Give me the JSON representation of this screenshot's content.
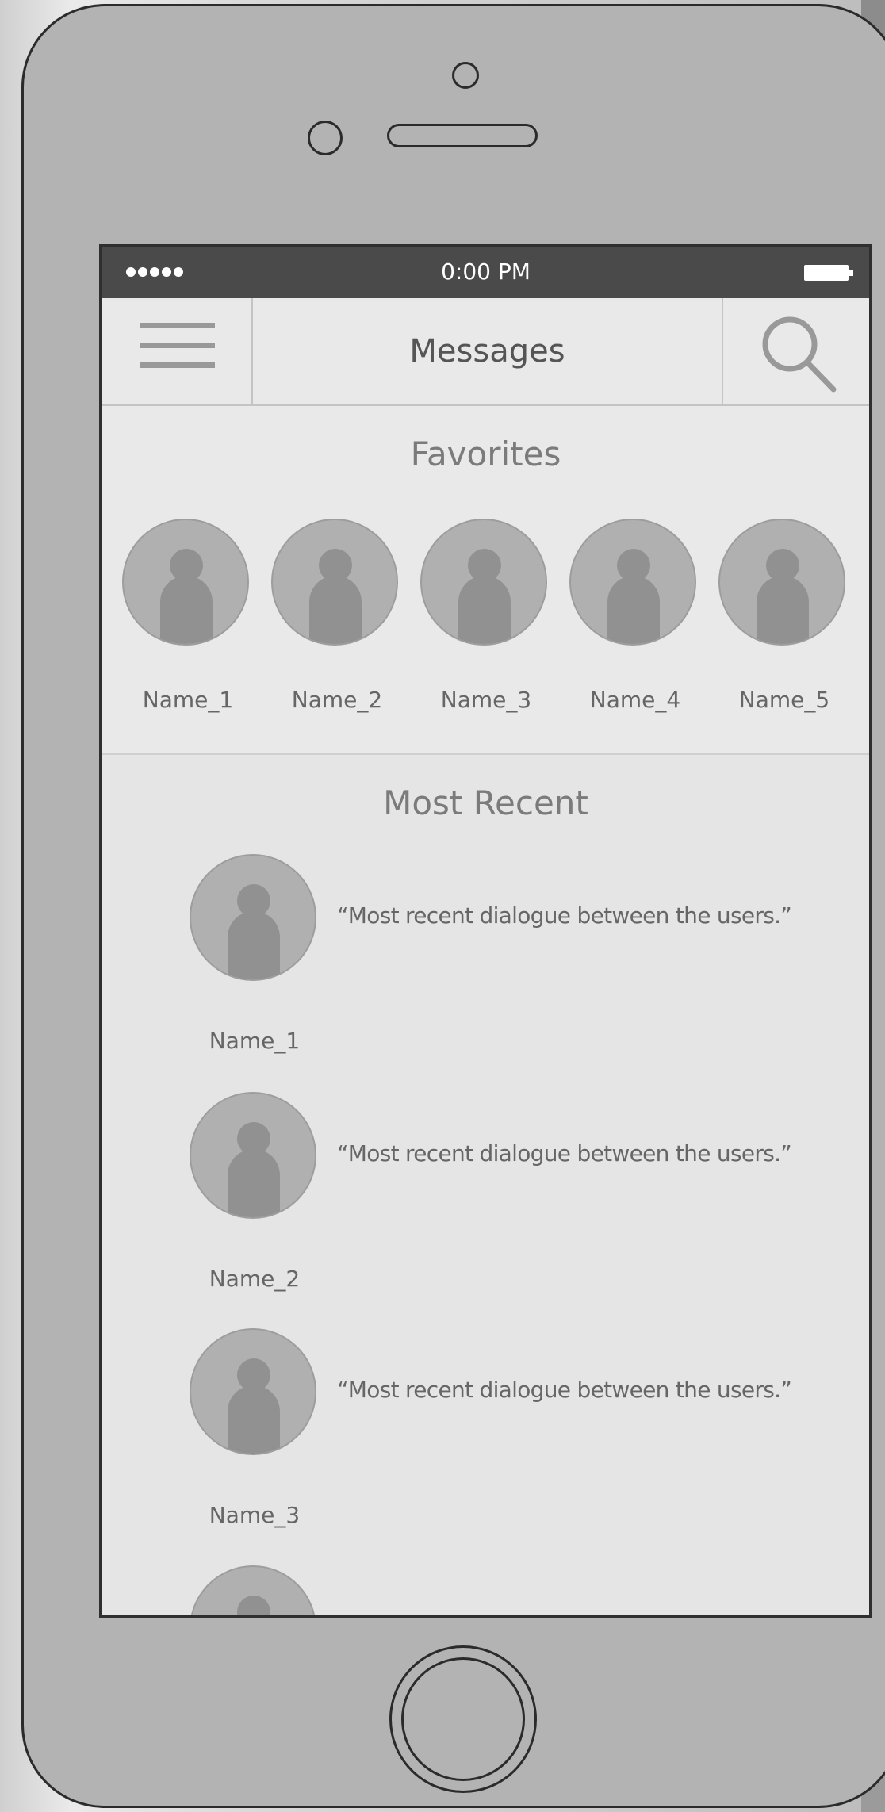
{
  "status_bar": {
    "time": "0:00 PM"
  },
  "nav": {
    "title": "Messages",
    "menu_icon": "hamburger-menu-icon",
    "search_icon": "search-icon"
  },
  "favorites": {
    "title": "Favorites",
    "items": [
      {
        "name": "Name_1"
      },
      {
        "name": "Name_2"
      },
      {
        "name": "Name_3"
      },
      {
        "name": "Name_4"
      },
      {
        "name": "Name_5"
      }
    ]
  },
  "recent": {
    "title": "Most Recent",
    "items": [
      {
        "name": "Name_1",
        "message": "“Most recent dialogue between the users.”"
      },
      {
        "name": "Name_2",
        "message": "“Most recent dialogue between the users.”"
      },
      {
        "name": "Name_3",
        "message": "“Most recent dialogue between the users.”"
      },
      {
        "name": "",
        "message": ""
      }
    ]
  },
  "colors": {
    "status_bar": "#4a4a4a",
    "screen_background": "#e5e5e5",
    "avatar": "#b0b0b0",
    "accent_text": "#7b7b7b"
  }
}
